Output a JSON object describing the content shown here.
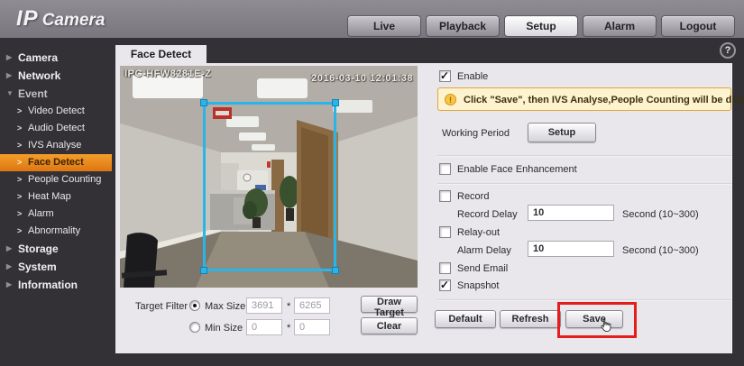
{
  "header": {
    "logo": {
      "ip": "IP",
      "camera": "Camera"
    },
    "tabs": [
      {
        "label": "Live",
        "active": false
      },
      {
        "label": "Playback",
        "active": false
      },
      {
        "label": "Setup",
        "active": true
      },
      {
        "label": "Alarm",
        "active": false
      },
      {
        "label": "Logout",
        "active": false
      }
    ]
  },
  "sidebar": {
    "items": [
      {
        "label": "Camera",
        "kind": "group",
        "expanded": false,
        "active": false
      },
      {
        "label": "Network",
        "kind": "group",
        "expanded": false,
        "active": false
      },
      {
        "label": "Event",
        "kind": "group",
        "expanded": true,
        "active": false
      },
      {
        "label": "Video Detect",
        "kind": "sub",
        "active": false
      },
      {
        "label": "Audio Detect",
        "kind": "sub",
        "active": false
      },
      {
        "label": "IVS Analyse",
        "kind": "sub",
        "active": false
      },
      {
        "label": "Face Detect",
        "kind": "sub",
        "active": true
      },
      {
        "label": "People Counting",
        "kind": "sub",
        "active": false
      },
      {
        "label": "Heat Map",
        "kind": "sub",
        "active": false
      },
      {
        "label": "Alarm",
        "kind": "sub",
        "active": false
      },
      {
        "label": "Abnormality",
        "kind": "sub",
        "active": false
      },
      {
        "label": "Storage",
        "kind": "group",
        "expanded": false,
        "active": false
      },
      {
        "label": "System",
        "kind": "group",
        "expanded": false,
        "active": false
      },
      {
        "label": "Information",
        "kind": "group",
        "expanded": false,
        "active": false
      }
    ]
  },
  "content": {
    "page_tab": "Face Detect",
    "help_glyph": "?",
    "video": {
      "camera_name": "IPC-HFW8281E-Z",
      "timestamp": "2016-03-10 12:01:38"
    },
    "target_filter": {
      "label": "Target Filter",
      "max_size": {
        "label": "Max Size",
        "selected": true,
        "w": "3691",
        "h": "6265"
      },
      "min_size": {
        "label": "Min Size",
        "selected": false,
        "w": "0",
        "h": "0"
      },
      "mult_sign": "*",
      "draw_target": "Draw Target",
      "clear": "Clear"
    },
    "settings": {
      "enable": {
        "label": "Enable",
        "checked": true
      },
      "warning": "Click \"Save\", then IVS Analyse,People Counting will be disabled!",
      "warning_glyph": "!",
      "working_period": {
        "label": "Working Period",
        "button": "Setup"
      },
      "face_enhancement": {
        "label": "Enable Face Enhancement",
        "checked": false
      },
      "record": {
        "label": "Record",
        "checked": false
      },
      "record_delay": {
        "label": "Record Delay",
        "value": "10",
        "unit": "Second (10~300)"
      },
      "relay_out": {
        "label": "Relay-out",
        "checked": false
      },
      "alarm_delay": {
        "label": "Alarm Delay",
        "value": "10",
        "unit": "Second (10~300)"
      },
      "send_email": {
        "label": "Send Email",
        "checked": false
      },
      "snapshot": {
        "label": "Snapshot",
        "checked": true
      },
      "buttons": {
        "default": "Default",
        "refresh": "Refresh",
        "save": "Save"
      }
    },
    "colors": {
      "accent_orange": "#ee8b18",
      "detect_box_cyan": "#2ab4e8",
      "annotation_red": "#e41d1d",
      "warning_border": "#e3a53c",
      "warning_bg": "#fdf3cf",
      "panel_bg": "#e9e6ec",
      "chrome_dark": "#333136"
    }
  }
}
